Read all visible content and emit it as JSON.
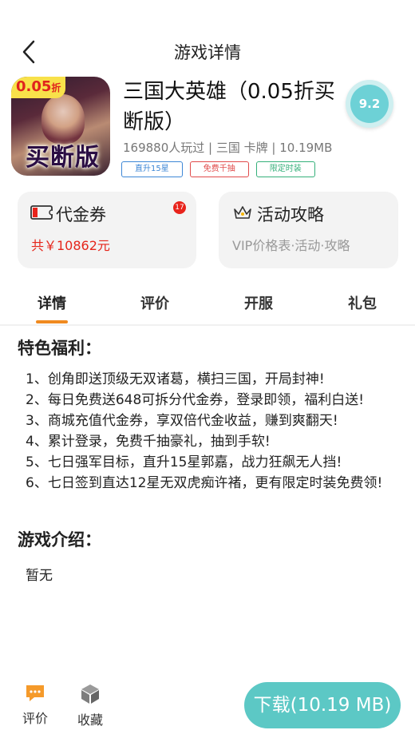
{
  "header": {
    "title": "游戏详情"
  },
  "game": {
    "icon_badge": "0.05",
    "icon_badge_suffix": "折",
    "icon_art_text": "买断版",
    "name": "三国大英雄（0.05折买断版）",
    "meta": "169880人玩过 | 三国 卡牌 | 10.19MB",
    "tags": [
      "直升15星",
      "免费千抽",
      "限定时装"
    ],
    "score": "9.2"
  },
  "voucher_card": {
    "title": "代金券",
    "badge": "17",
    "subtitle": "共￥10862元"
  },
  "guide_card": {
    "title": "活动攻略",
    "subtitle": "VIP价格表·活动·攻略"
  },
  "tabs": [
    {
      "label": "详情",
      "active": true
    },
    {
      "label": "评价"
    },
    {
      "label": "开服"
    },
    {
      "label": "礼包"
    }
  ],
  "features": {
    "title": "特色福利：",
    "items": [
      "1、创角即送顶级无双诸葛，横扫三国，开局封神!",
      "2、每日免费送648可拆分代金券，登录即领，福利白送!",
      "3、商城充值代金券，享双倍代金收益，赚到爽翻天!",
      "4、累计登录，免费千抽豪礼，抽到手软!",
      "5、七日强军目标，直升15星郭嘉，战力狂飙无人挡!",
      "6、七日签到直达12星无双虎痴许褚，更有限定时装免费领!"
    ]
  },
  "intro": {
    "title": "游戏介绍：",
    "text": "暂无"
  },
  "bottom": {
    "review_label": "评价",
    "favorite_label": "收藏",
    "download_label": "下载(10.19 MB)"
  },
  "colors": {
    "accent": "#f08a20",
    "download": "#5cc8c5",
    "score": "#6dd1d6",
    "price_red": "#e5261b"
  }
}
